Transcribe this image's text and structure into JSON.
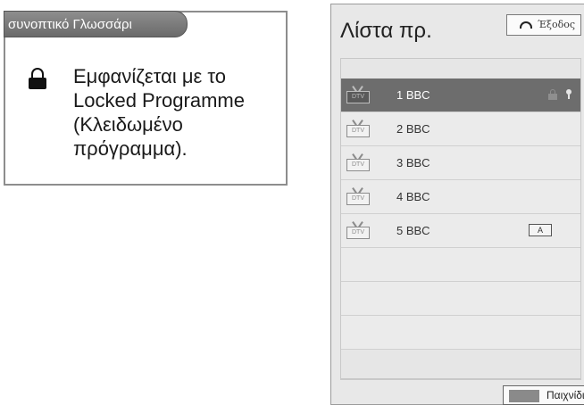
{
  "glossary": {
    "tab_title": "συνοπτικό Γλωσσάρι",
    "entries": [
      {
        "icon": "lock-icon",
        "lines": [
          "Εμφανίζεται με το",
          "Locked Programme",
          "(Κλειδωμένο",
          "πρόγραμμα)."
        ]
      }
    ]
  },
  "panel": {
    "title": "Λίστα πρ.",
    "exit_label": "Έξοδος",
    "channels": [
      {
        "badge": "DTV",
        "name": "1 BBC",
        "selected": true,
        "locked": true
      },
      {
        "badge": "DTV",
        "name": "2 BBC",
        "selected": false
      },
      {
        "badge": "DTV",
        "name": "3 BBC",
        "selected": false
      },
      {
        "badge": "DTV",
        "name": "4 BBC",
        "selected": false
      },
      {
        "badge": "DTV",
        "name": "5 BBC",
        "selected": false,
        "audio_badge": "A"
      }
    ],
    "game_label": "Παιχνίδι"
  }
}
